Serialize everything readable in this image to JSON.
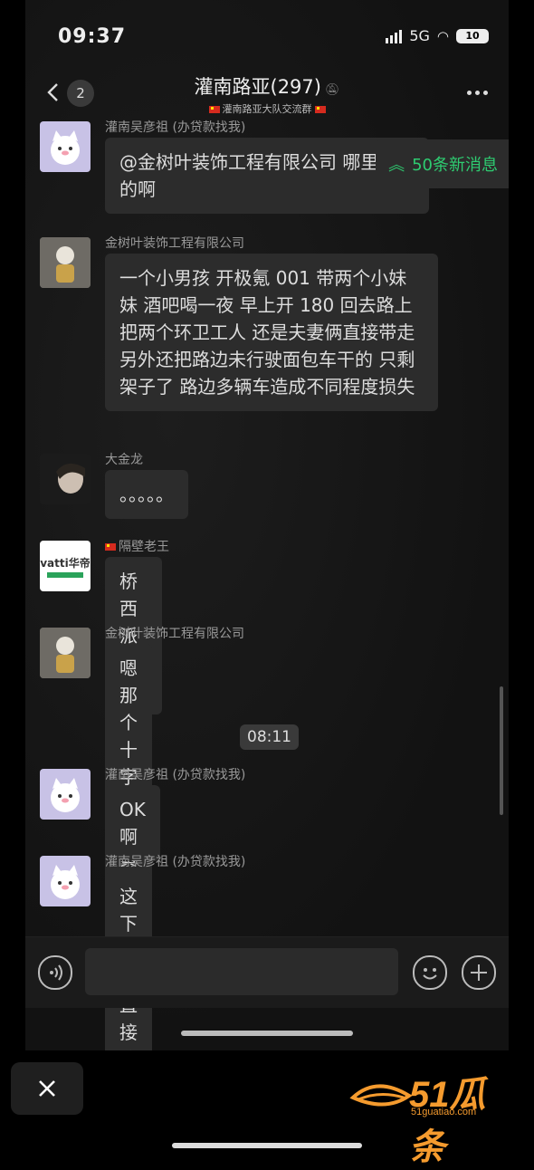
{
  "status_bar": {
    "time": "09:37",
    "network": "5G",
    "battery": "10"
  },
  "header": {
    "back_count": "2",
    "title": "灌南路亚(297)",
    "subtitle": "灌南路亚大队交流群"
  },
  "new_messages_label": "50条新消息",
  "messages": [
    {
      "sender": "灌南吴彦祖 (办贷款找我)",
      "text": "@金树叶装饰工程有限公司 哪里撞的啊"
    },
    {
      "sender": "金树叶装饰工程有限公司",
      "text": "一个小男孩 开极氪 001 带两个小妹妹 酒吧喝一夜 早上开 180 回去路上 把两个环卫工人 还是夫妻俩直接带走 另外还把路边未行驶面包车干的 只剩架子了 路边多辆车造成不同程度损失"
    },
    {
      "sender": "大金龙",
      "text": "。。。。。"
    },
    {
      "sender": "隔壁老王",
      "text": "桥西派出所?"
    },
    {
      "sender": "金树叶装饰工程有限公司",
      "text": "嗯 那个十字路口 黄埔北门"
    },
    {
      "sender": "灌南吴彦祖 (办贷款找我)",
      "text": "OK啊"
    },
    {
      "sender": "灌南吴彦祖 (办贷款找我)",
      "text": "这下可以直接枪毙了"
    }
  ],
  "time_divider": "08:11",
  "avatar_vatti_text": "vatti华帝",
  "watermark": {
    "number": "51瓜条",
    "url": "51guatiao.com"
  },
  "icons": {
    "back": "chevron-left-icon",
    "mute": "bell-off-icon",
    "more": "more-icon",
    "voice": "voice-icon",
    "emoji": "smile-icon",
    "plus": "plus-icon",
    "close": "close-icon",
    "new_msg": "double-chevron-up-icon"
  },
  "colors": {
    "accent_green": "#2ecc71",
    "bubble": "#2c2c2c",
    "logo_orange": "#f59b2e"
  }
}
